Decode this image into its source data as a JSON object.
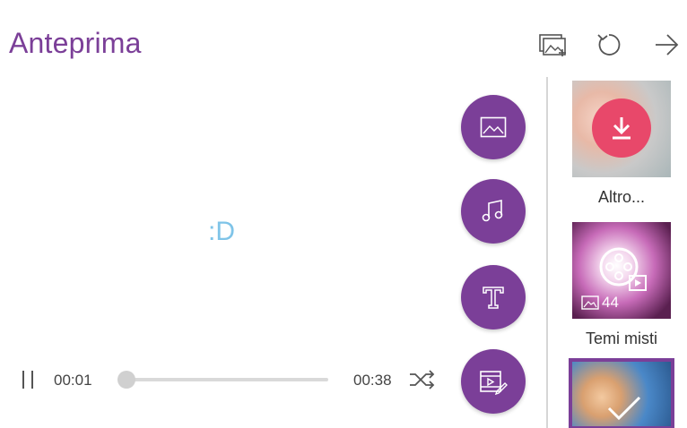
{
  "header": {
    "title": "Anteprima"
  },
  "preview": {
    "text": ":D"
  },
  "player": {
    "current_time": "00:01",
    "total_time": "00:38",
    "progress": 0.03
  },
  "fabs": [
    "image-icon",
    "music-icon",
    "text-icon",
    "video-edit-icon"
  ],
  "themes": [
    {
      "label": "Altro...",
      "icon": "download-icon"
    },
    {
      "label": "Temi misti",
      "count": "44",
      "icon": "film-reel-icon"
    },
    {
      "label": "",
      "selected": true,
      "icon": "check-icon"
    }
  ],
  "colors": {
    "accent": "#7b3f98",
    "download": "#e8486a",
    "preview_text": "#7fc4e8"
  }
}
